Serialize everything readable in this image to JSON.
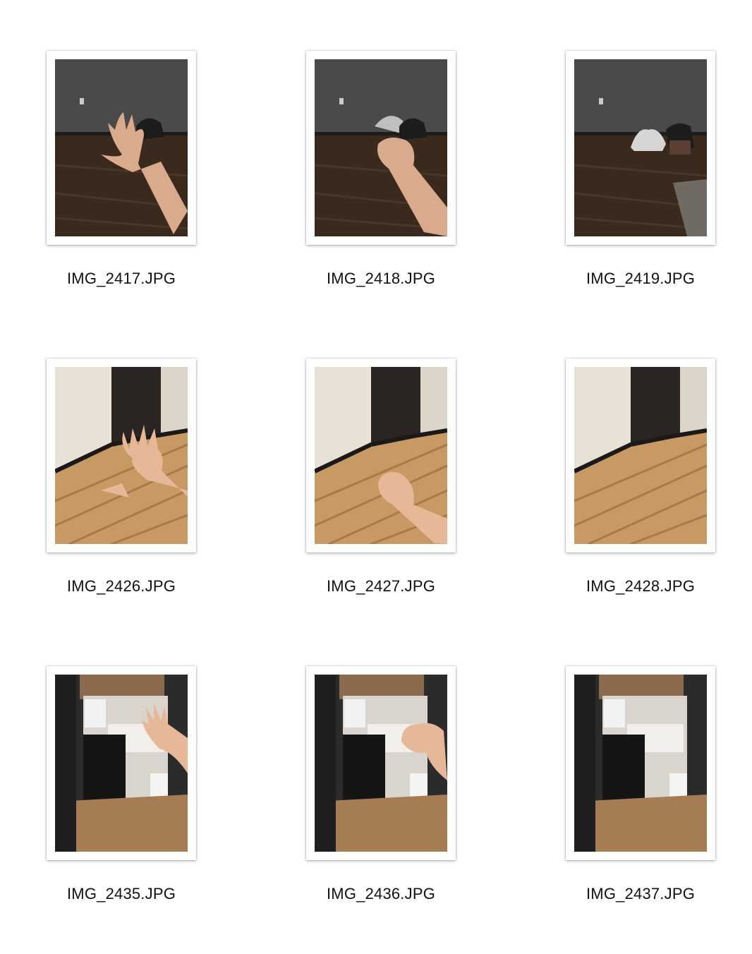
{
  "files": [
    {
      "name": "IMG_2417.JPG",
      "scene": "dark-room",
      "subject": "open-hand"
    },
    {
      "name": "IMG_2418.JPG",
      "scene": "dark-room",
      "subject": "fist"
    },
    {
      "name": "IMG_2419.JPG",
      "scene": "dark-room",
      "subject": "none"
    },
    {
      "name": "IMG_2426.JPG",
      "scene": "hallway-floor",
      "subject": "open-hand"
    },
    {
      "name": "IMG_2427.JPG",
      "scene": "hallway-floor",
      "subject": "fist"
    },
    {
      "name": "IMG_2428.JPG",
      "scene": "hallway-floor",
      "subject": "none"
    },
    {
      "name": "IMG_2435.JPG",
      "scene": "kitchen",
      "subject": "open-hand"
    },
    {
      "name": "IMG_2436.JPG",
      "scene": "kitchen",
      "subject": "fist"
    },
    {
      "name": "IMG_2437.JPG",
      "scene": "kitchen",
      "subject": "none"
    }
  ]
}
